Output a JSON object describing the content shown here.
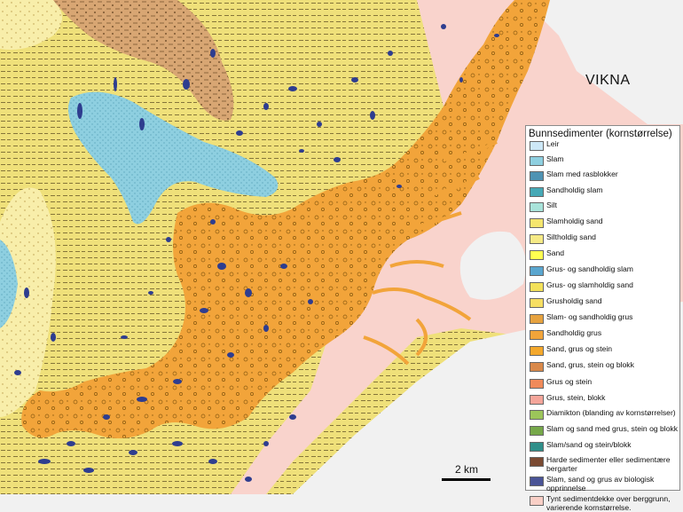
{
  "map": {
    "place_label": "VIKNA",
    "scale_label": "2 km"
  },
  "legend": {
    "title": "Bunnsedimenter (kornstørrelse)",
    "items": [
      {
        "label": "Leir",
        "color": "#cde8f7"
      },
      {
        "label": "Slam",
        "color": "#8ecfe0"
      },
      {
        "label": "Slam med rasblokker",
        "color": "#4f93b3"
      },
      {
        "label": "Sandholdig slam",
        "color": "#46a9b6"
      },
      {
        "label": "Silt",
        "color": "#a8e3da"
      },
      {
        "label": "Slamholdig sand",
        "color": "#f5e66e"
      },
      {
        "label": "Siltholdig sand",
        "color": "#f6ea86"
      },
      {
        "label": "Sand",
        "color": "#ffff50"
      },
      {
        "label": "Grus- og sandholdig slam",
        "color": "#5aa6cf"
      },
      {
        "label": "Grus- og slamholdig sand",
        "color": "#f3e15a"
      },
      {
        "label": "Grusholdig sand",
        "color": "#f7df62"
      },
      {
        "label": "Slam- og sandholdig grus",
        "color": "#e6a23f"
      },
      {
        "label": "Sandholdig grus",
        "color": "#f2a43a"
      },
      {
        "label": "Sand, grus og stein",
        "color": "#f4a82c"
      },
      {
        "label": "Sand, grus, stein og blokk",
        "color": "#d9894a"
      },
      {
        "label": "Grus og stein",
        "color": "#f08a5a"
      },
      {
        "label": "Grus, stein, blokk",
        "color": "#f4a59a"
      },
      {
        "label": "Diamikton (blanding av kornstørrelser)",
        "color": "#9cc55a"
      },
      {
        "label": "Slam og sand med grus, stein og blokk",
        "color": "#76a84a"
      },
      {
        "label": "Slam/sand og stein/blokk",
        "color": "#2f8f8a"
      },
      {
        "label": "Harde sedimenter eller sedimentære bergarter",
        "color": "#7a4a32"
      },
      {
        "label": "Slam, sand og grus av biologisk opprinnelse",
        "color": "#4a5496"
      },
      {
        "label": "Tynt sedimentdekke over berggrunn, varierende kornstørrelse.",
        "color": "#f9cfc6"
      }
    ]
  },
  "map_colors": {
    "slamholdig_sand": "#efe07a",
    "siltholdig_sand": "#f8eeaa",
    "slam": "#8ecfe0",
    "grus": "#f2a43a",
    "slam_grus": "#d8a673",
    "tynt": "#f9d3cc",
    "biologisk": "#2e3d8f",
    "land": "#f1f1f1"
  }
}
